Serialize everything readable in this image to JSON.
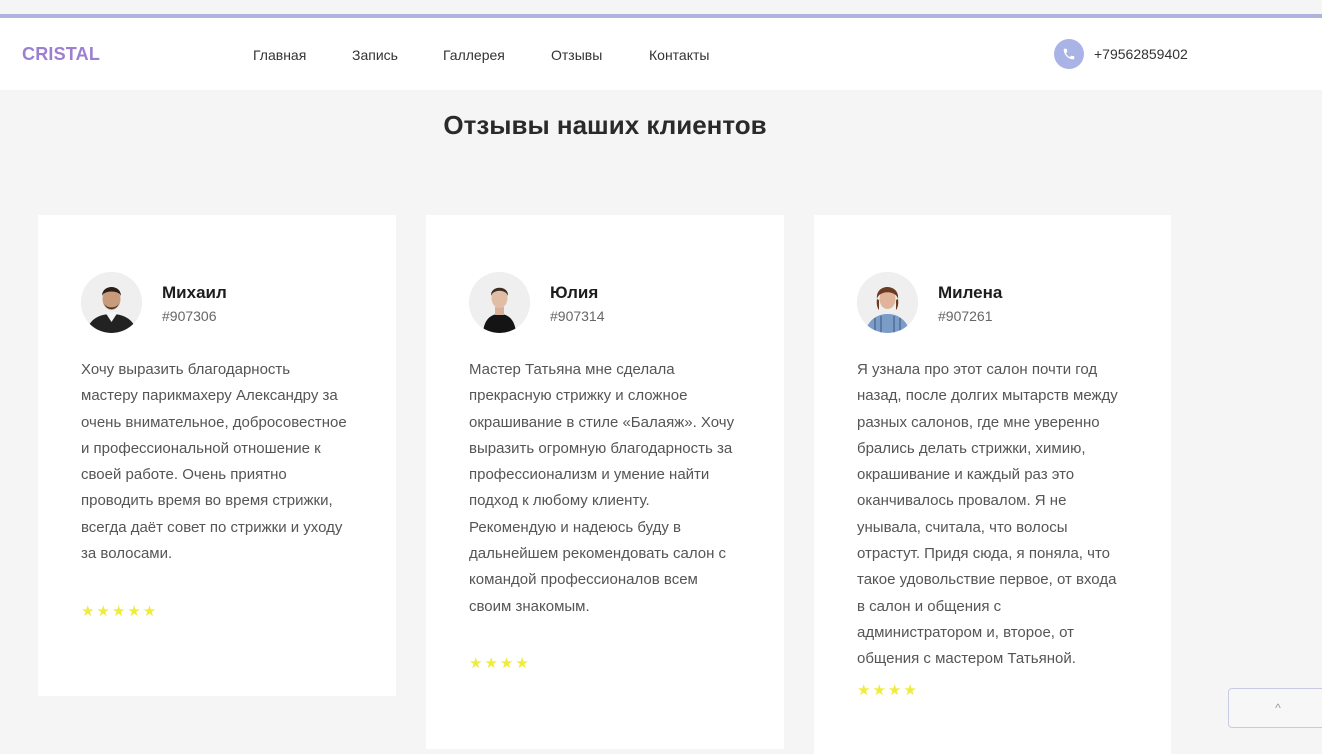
{
  "header": {
    "logo": "CRISTAL",
    "nav": [
      "Главная",
      "Запись",
      "Галлерея",
      "Отзывы",
      "Контакты"
    ],
    "phone": "+79562859402"
  },
  "main": {
    "title": "Отзывы наших клиентов",
    "reviews": [
      {
        "name": "Михаил",
        "code": "#907306",
        "text": "Хочу выразить благодарность мастеру парикмахеру Александру за очень внимательное, добросовестное и профессиональной отношение к своей работе. Очень приятно проводить время во время стрижки, всегда даёт совет по стрижки и уходу за волосами.",
        "rating": 5,
        "stars": "★★★★★"
      },
      {
        "name": "Юлия",
        "code": "#907314",
        "text": "Мастер Татьяна мне сделала прекрасную стрижку и сложное окрашивание в стиле «Балаяж». Хочу выразить огромную благодарность за профессионализм и умение найти подход к любому клиенту. Рекомендую и надеюсь буду в дальнейшем рекомендовать салон с командой профессионалов всем своим знакомым.",
        "rating": 4,
        "stars": "★★★★"
      },
      {
        "name": "Милена",
        "code": "#907261",
        "text": "Я узнала про этот салон почти год назад, после долгих мытарств между разных салонов, где мне уверенно брались делать стрижки, химию, окрашивание и каждый раз это оканчивалось провалом. Я не унывала, считала, что волосы отрастут. Придя сюда, я поняла, что такое удовольствие первое, от входа в салон и общения с администратором и, второе, от общения с мастером Татьяной.",
        "rating": 4,
        "stars": "★★★★"
      }
    ]
  },
  "scroll_top": {
    "icon": "^"
  }
}
